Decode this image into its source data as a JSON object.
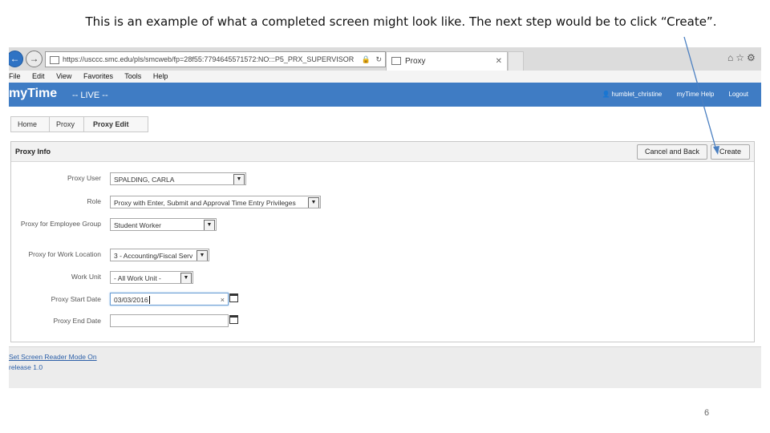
{
  "caption": "This is an example of what a completed screen might look like.  The next step would be to click “Create”.",
  "slide_number": "6",
  "browser": {
    "url": "https://usccc.smc.edu/pls/smcweb/fp=28f55:7794645571572:NO:::P5_PRX_SUPERVISOR",
    "tab_title": "Proxy",
    "menu": [
      "File",
      "Edit",
      "View",
      "Favorites",
      "Tools",
      "Help"
    ],
    "icons": [
      "home-icon",
      "star-icon",
      "gear-icon"
    ]
  },
  "app": {
    "title": "myTime",
    "environment": "-- LIVE --",
    "user": "humblet_christine",
    "help": "myTime Help",
    "logout": "Logout"
  },
  "breadcrumb": [
    "Home",
    "Proxy",
    "Proxy Edit"
  ],
  "panel": {
    "title": "Proxy Info",
    "cancel_label": "Cancel and Back",
    "create_label": "Create"
  },
  "fields": {
    "proxy_user": {
      "label": "Proxy User",
      "value": "SPALDING, CARLA"
    },
    "role": {
      "label": "Role",
      "value": "Proxy with Enter, Submit and Approval Time Entry Privileges"
    },
    "employee_group": {
      "label": "Proxy for Employee Group",
      "value": "Student Worker"
    },
    "work_location": {
      "label": "Proxy for Work Location",
      "value": "3 - Accounting/Fiscal Serv"
    },
    "work_unit": {
      "label": "Work Unit",
      "value": "- All Work Unit -"
    },
    "start_date": {
      "label": "Proxy Start Date",
      "value": "03/03/2016"
    },
    "end_date": {
      "label": "Proxy End Date",
      "value": ""
    }
  },
  "footer": {
    "screen_reader": "Set Screen Reader Mode On",
    "release": "release 1.0"
  }
}
